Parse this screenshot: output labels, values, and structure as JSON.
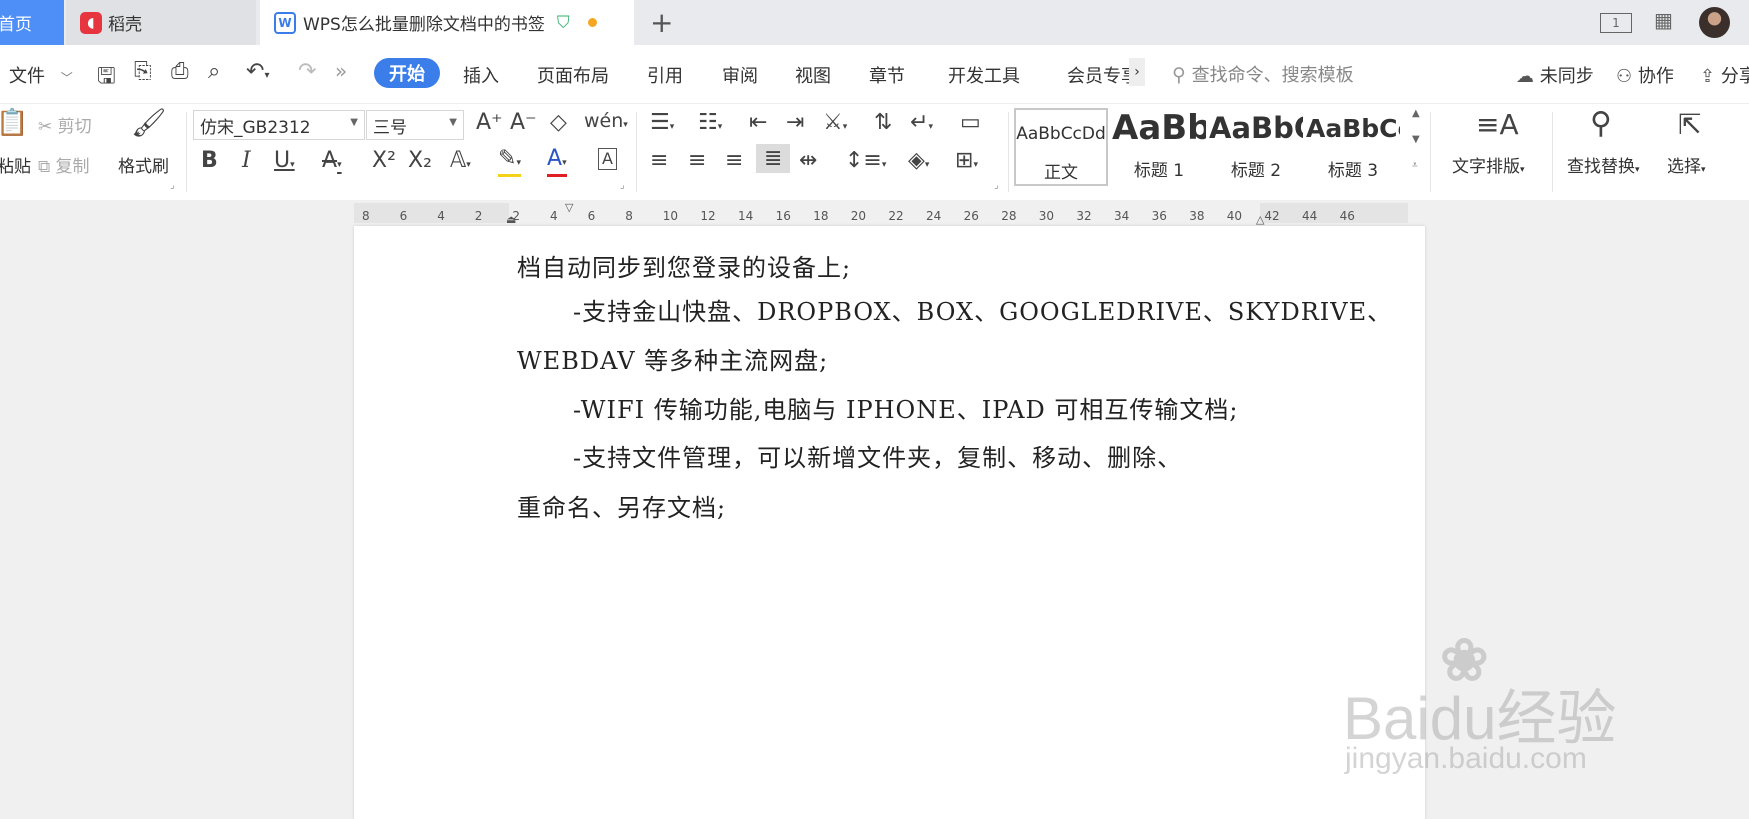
{
  "tabs": {
    "home": "首页",
    "daoke": "稻壳",
    "active_doc": "WPS怎么批量删除文档中的书签",
    "page_counter": "1"
  },
  "menu": {
    "file": "文件",
    "items": [
      "开始",
      "插入",
      "页面布局",
      "引用",
      "审阅",
      "视图",
      "章节",
      "开发工具",
      "会员专享"
    ],
    "search_placeholder": "查找命令、搜索模板",
    "sync": "未同步",
    "collab": "协作",
    "share": "分享"
  },
  "ribbon": {
    "paste": "粘贴",
    "cut": "剪切",
    "copy": "复制",
    "format_painter": "格式刷",
    "font_name": "仿宋_GB2312",
    "font_size": "三号",
    "styles": [
      {
        "sample": "AaBbCcDd",
        "name": "正文"
      },
      {
        "sample": "AaBb",
        "name": "标题 1"
      },
      {
        "sample": "AaBbC",
        "name": "标题 2"
      },
      {
        "sample": "AaBbCc",
        "name": "标题 3"
      }
    ],
    "text_layout": "文字排版",
    "find_replace": "查找替换",
    "select": "选择"
  },
  "ruler": {
    "ticks": [
      "8",
      "6",
      "4",
      "2",
      "2",
      "4",
      "6",
      "8",
      "10",
      "12",
      "14",
      "16",
      "18",
      "20",
      "22",
      "24",
      "26",
      "28",
      "30",
      "32",
      "34",
      "36",
      "38",
      "40",
      "42",
      "44",
      "46"
    ]
  },
  "document": {
    "lines": [
      "档自动同步到您登录的设备上;",
      "-支持金山快盘、DROPBOX、BOX、GOOGLEDRIVE、SKYDRIVE、",
      "WEBDAV 等多种主流网盘;",
      "-WIFI 传输功能,电脑与 IPHONE、IPAD 可相互传输文档;",
      "-支持文件管理，可以新增文件夹，复制、移动、删除、",
      "重命名、另存文档;"
    ]
  },
  "watermark": {
    "brand": "Baidu经验",
    "url": "jingyan.baidu.com"
  },
  "colors": {
    "accent": "#3b7ee9",
    "home_tab": "#4e8ef7",
    "daoke_red": "#e6353f"
  }
}
